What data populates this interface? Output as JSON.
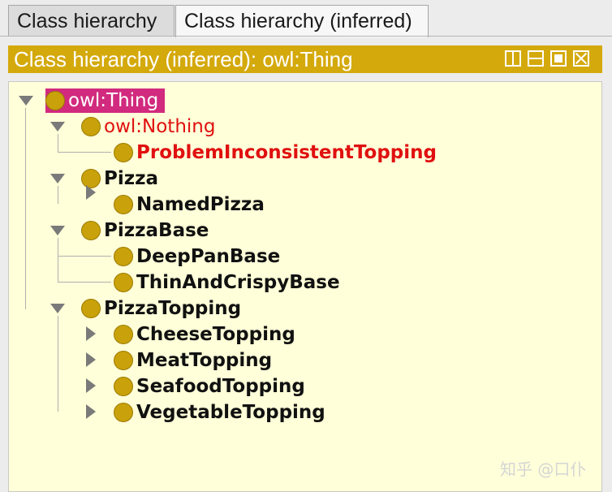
{
  "tabs": [
    {
      "label": "Class hierarchy",
      "active": false
    },
    {
      "label": "Class hierarchy (inferred)",
      "active": true
    }
  ],
  "view": {
    "title": "Class hierarchy (inferred): owl:Thing",
    "buttons": [
      "split-view-icon",
      "minimize-icon",
      "maximize-icon",
      "close-icon"
    ]
  },
  "tree": {
    "root": "owl:Thing",
    "nodes": [
      {
        "label": "owl:Thing"
      },
      {
        "label": "owl:Nothing"
      },
      {
        "label": "ProblemInconsistentTopping"
      },
      {
        "label": "Pizza"
      },
      {
        "label": "NamedPizza"
      },
      {
        "label": "PizzaBase"
      },
      {
        "label": "DeepPanBase"
      },
      {
        "label": "ThinAndCrispyBase"
      },
      {
        "label": "PizzaTopping"
      },
      {
        "label": "CheeseTopping"
      },
      {
        "label": "MeatTopping"
      },
      {
        "label": "SeafoodTopping"
      },
      {
        "label": "VegetableTopping"
      }
    ]
  },
  "colors": {
    "header": "#d4a90c",
    "panel": "#ffffd9",
    "selection": "#d12a7e",
    "inconsistent": "#e01010",
    "class_dot": "#c9a10a"
  },
  "watermark": "知乎 @口仆"
}
